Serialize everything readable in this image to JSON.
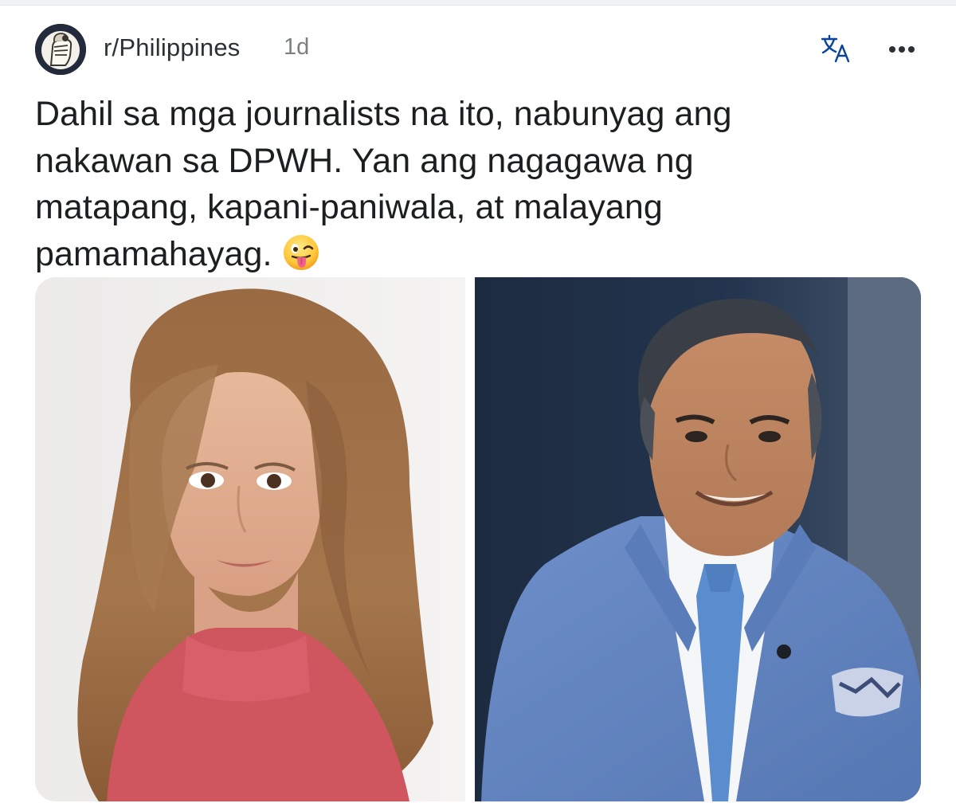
{
  "post": {
    "subreddit": "r/Philippines",
    "age": "1d",
    "title_lines": [
      "Dahil sa mga journalists na ito, nabunyag ang",
      "nakawan sa DPWH. Yan ang nagagawa ng",
      "matapang, kapani-paniwala, at malayang",
      "pamamahayag."
    ],
    "title_emoji": "winking-face-with-tongue",
    "icons": {
      "avatar": "raised-fist-avatar",
      "translate": "translate-icon",
      "more": "more-options-icon"
    }
  },
  "colors": {
    "text": "#1c1f21",
    "meta": "#7a7f83",
    "accent": "#0a449b",
    "divider": "#e4e6e8"
  }
}
